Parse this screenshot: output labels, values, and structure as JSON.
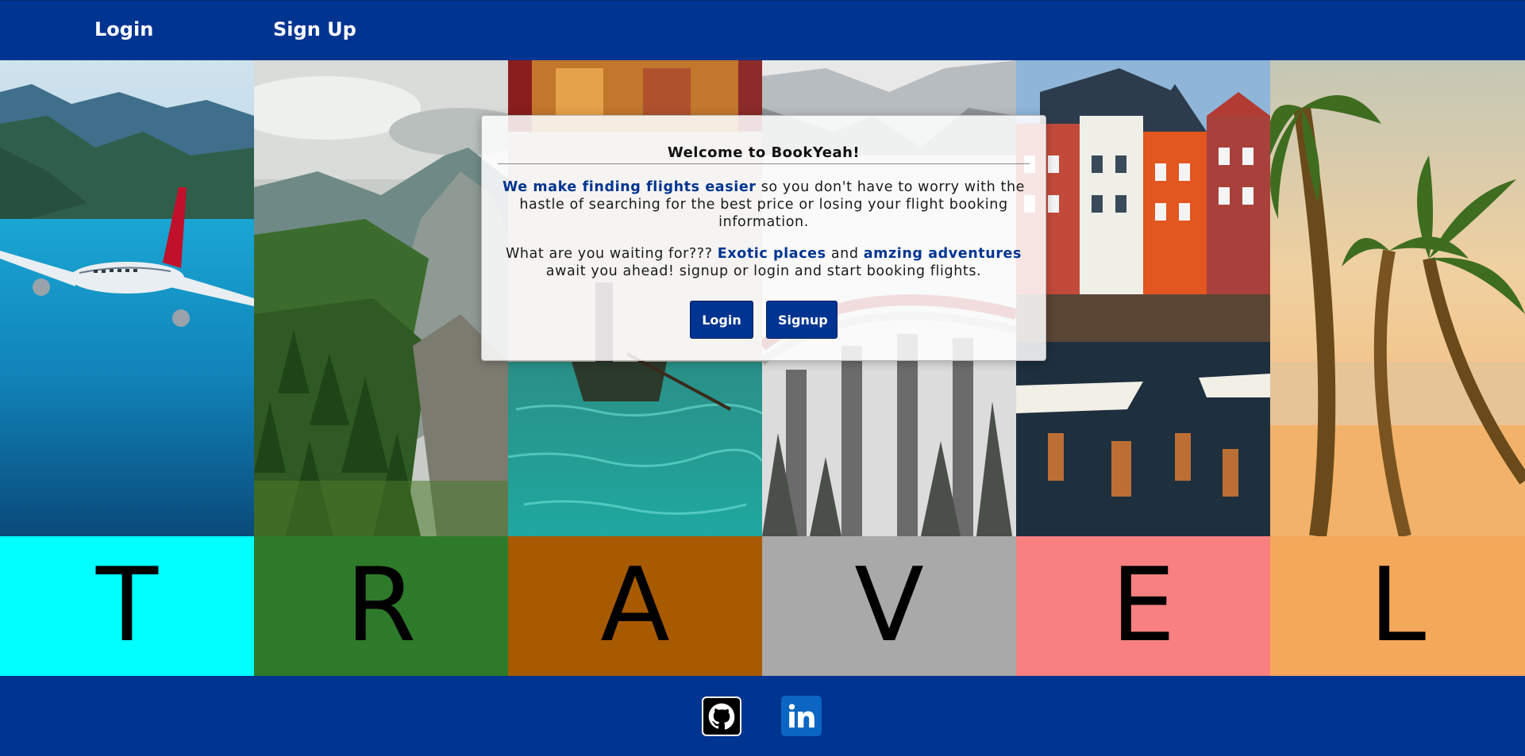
{
  "nav": {
    "login_label": "Login",
    "signup_label": "Sign Up"
  },
  "modal": {
    "title": "Welcome to BookYeah!",
    "p1_highlight": "We make finding flights easier",
    "p1_rest": " so you don't have to worry with the hastle of searching for the best price or losing your flight booking information.",
    "p2_start": "What are you waiting for??? ",
    "p2_hl1": "Exotic places",
    "p2_mid": " and ",
    "p2_hl2": "amzing adventures",
    "p2_end": " await you ahead! signup or login and start booking flights.",
    "login_label": "Login",
    "signup_label": "Signup"
  },
  "tiles": [
    {
      "letter": "T",
      "color": "#00ffff",
      "photo": "airplane-over-lake-icon"
    },
    {
      "letter": "R",
      "color": "#2e7a2b",
      "photo": "mountain-forest-icon"
    },
    {
      "letter": "A",
      "color": "#a85a00",
      "photo": "venice-gondola-icon"
    },
    {
      "letter": "V",
      "color": "#a9a9a9",
      "photo": "snowy-viaduct-train-icon"
    },
    {
      "letter": "E",
      "color": "#f88080",
      "photo": "harbor-colorful-houses-icon"
    },
    {
      "letter": "L",
      "color": "#f4a85a",
      "photo": "palm-beach-sunset-icon"
    }
  ],
  "footer": {
    "github_icon": "github-icon",
    "linkedin_icon": "linkedin-icon"
  },
  "colors": {
    "brand": "#003491"
  }
}
